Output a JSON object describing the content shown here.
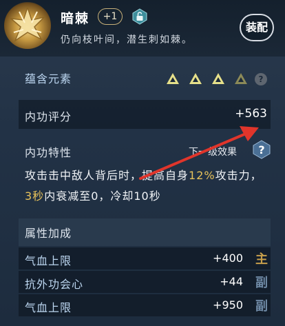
{
  "item": {
    "name": "暗棘",
    "level": "+1",
    "description": "仍向枝叶间，潜生刺如棘。",
    "equip_label": "装配"
  },
  "elements": {
    "label": "蕴含元素",
    "filled_count": 3,
    "total_count": 4,
    "help_label": "?"
  },
  "score": {
    "label": "内功评分",
    "value": "+563"
  },
  "traits": {
    "label": "内功特性",
    "next_level_label": "下一级效果",
    "help_label": "?",
    "desc_part1": "攻击击中敌人背后时，提高自身",
    "desc_hl1": "12%",
    "desc_part2": "攻击力，",
    "desc_hl2": "3秒",
    "desc_part3": "内衰减至0，冷却10秒"
  },
  "attributes": {
    "title": "属性加成",
    "rows": [
      {
        "name": "气血上限",
        "value": "+400",
        "tag": "主"
      },
      {
        "name": "抗外功会心",
        "value": "+44",
        "tag": "副"
      },
      {
        "name": "气血上限",
        "value": "+950",
        "tag": "副"
      }
    ]
  },
  "colors": {
    "accent_gold": "#e8c25a",
    "annotation_red": "#e0352b",
    "element_filled": "#e6e08a",
    "element_dim": "#8c8a58"
  },
  "icons": {
    "item": "thorn-emblem-icon",
    "lock": "lock-open-icon",
    "element": "triangle-element-icon",
    "help": "question-icon",
    "annotation": "red-arrow"
  }
}
